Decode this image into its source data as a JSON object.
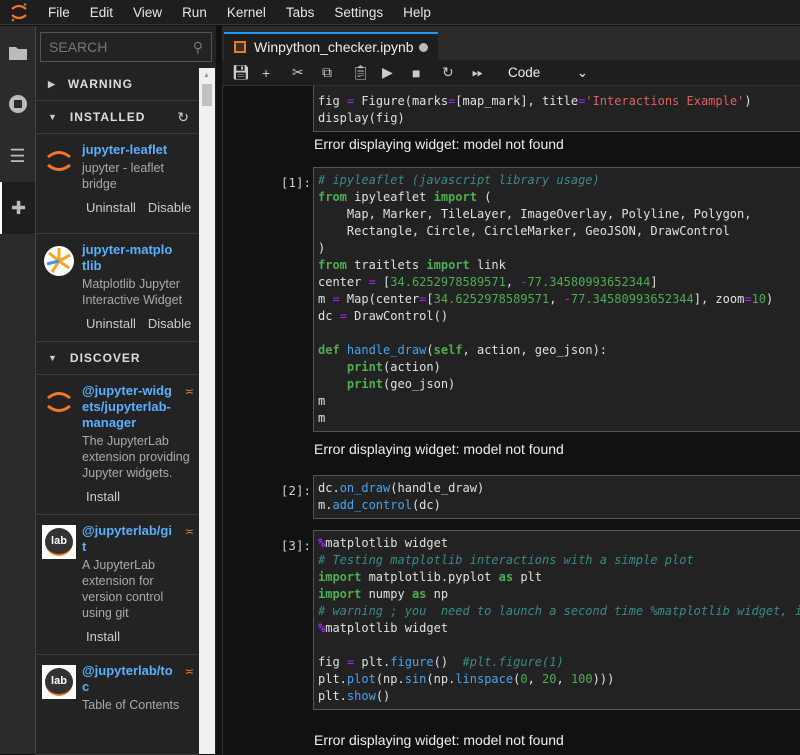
{
  "menubar": {
    "items": [
      "File",
      "Edit",
      "View",
      "Run",
      "Kernel",
      "Tabs",
      "Settings",
      "Help"
    ]
  },
  "sidebar": {
    "search_placeholder": "SEARCH",
    "sections": {
      "warning": "WARNING",
      "installed": "INSTALLED",
      "discover": "DISCOVER"
    },
    "installed": [
      {
        "name": "jupyter-leaflet",
        "desc": "jupyter - leaflet bridge",
        "buttons": [
          "Uninstall",
          "Disable"
        ]
      },
      {
        "name": "jupyter-matplotlib",
        "desc": "Matplotlib Jupyter Interactive Widget",
        "buttons": [
          "Uninstall",
          "Disable"
        ]
      }
    ],
    "discover": [
      {
        "name": "@jupyter-widgets/jupyterlab-manager",
        "desc": "The JupyterLab extension providing Jupyter widgets.",
        "button": "Install",
        "logo": "jupyter"
      },
      {
        "name": "@jupyterlab/git",
        "desc": "A JupyterLab extension for version control using git",
        "button": "Install",
        "logo": "lab"
      },
      {
        "name": "@jupyterlab/toc",
        "desc": "Table of Contents",
        "logo": "lab"
      }
    ]
  },
  "tab": {
    "title": "Winpython_checker.ipynb"
  },
  "toolbar": {
    "cell_type": "Code"
  },
  "cells": [
    {
      "prompt": "",
      "lines": [
        [
          [
            "p",
            "fig "
          ],
          [
            "o",
            "="
          ],
          [
            "p",
            " Figure(marks"
          ],
          [
            "o",
            "="
          ],
          [
            "p",
            "[map_mark], title"
          ],
          [
            "o",
            "="
          ],
          [
            "s",
            "'Interactions Example'"
          ],
          [
            "p",
            ")"
          ]
        ],
        [
          [
            "p",
            "display(fig)"
          ]
        ]
      ],
      "error": "Error displaying widget: model not found"
    },
    {
      "prompt": "[1]:",
      "lines": [
        [
          [
            "c",
            "# ipyleaflet (javascript library usage)"
          ]
        ],
        [
          [
            "k",
            "from"
          ],
          [
            "p",
            " ipyleaflet "
          ],
          [
            "k",
            "import"
          ],
          [
            "p",
            " ("
          ]
        ],
        [
          [
            "p",
            "    Map, Marker, TileLayer, ImageOverlay, Polyline, Polygon,"
          ]
        ],
        [
          [
            "p",
            "    Rectangle, Circle, CircleMarker, GeoJSON, DrawControl"
          ]
        ],
        [
          [
            "p",
            ")"
          ]
        ],
        [
          [
            "k",
            "from"
          ],
          [
            "p",
            " traitlets "
          ],
          [
            "k",
            "import"
          ],
          [
            "p",
            " link"
          ]
        ],
        [
          [
            "p",
            "center "
          ],
          [
            "o",
            "="
          ],
          [
            "p",
            " ["
          ],
          [
            "n",
            "34.6252978589571"
          ],
          [
            "p",
            ", "
          ],
          [
            "o",
            "-"
          ],
          [
            "n",
            "77.34580993652344"
          ],
          [
            "p",
            "]"
          ]
        ],
        [
          [
            "p",
            "m "
          ],
          [
            "o",
            "="
          ],
          [
            "p",
            " Map(center"
          ],
          [
            "o",
            "="
          ],
          [
            "p",
            "["
          ],
          [
            "n",
            "34.6252978589571"
          ],
          [
            "p",
            ", "
          ],
          [
            "o",
            "-"
          ],
          [
            "n",
            "77.34580993652344"
          ],
          [
            "p",
            "], zoom"
          ],
          [
            "o",
            "="
          ],
          [
            "n",
            "10"
          ],
          [
            "p",
            ")"
          ]
        ],
        [
          [
            "p",
            "dc "
          ],
          [
            "o",
            "="
          ],
          [
            "p",
            " DrawControl()"
          ]
        ],
        [
          [
            "p",
            ""
          ]
        ],
        [
          [
            "k",
            "def"
          ],
          [
            "f",
            " handle_draw"
          ],
          [
            "p",
            "("
          ],
          [
            "k",
            "self"
          ],
          [
            "p",
            ", action, geo_json):"
          ]
        ],
        [
          [
            "p",
            "    "
          ],
          [
            "k",
            "print"
          ],
          [
            "p",
            "(action)"
          ]
        ],
        [
          [
            "p",
            "    "
          ],
          [
            "k",
            "print"
          ],
          [
            "p",
            "(geo_json)"
          ]
        ],
        [
          [
            "p",
            "m"
          ]
        ],
        [
          [
            "p",
            "m"
          ]
        ]
      ],
      "error": "Error displaying widget: model not found"
    },
    {
      "prompt": "[2]:",
      "lines": [
        [
          [
            "p",
            "dc."
          ],
          [
            "f",
            "on_draw"
          ],
          [
            "p",
            "(handle_draw)"
          ]
        ],
        [
          [
            "p",
            "m."
          ],
          [
            "f",
            "add_control"
          ],
          [
            "p",
            "(dc)"
          ]
        ]
      ]
    },
    {
      "prompt": "[3]:",
      "lines": [
        [
          [
            "m",
            "%"
          ],
          [
            "p",
            "matplotlib widget"
          ]
        ],
        [
          [
            "c",
            "# Testing matplotlib interactions with a simple plot"
          ]
        ],
        [
          [
            "k",
            "import"
          ],
          [
            "p",
            " matplotlib.pyplot "
          ],
          [
            "k",
            "as"
          ],
          [
            "p",
            " plt"
          ]
        ],
        [
          [
            "k",
            "import"
          ],
          [
            "p",
            " numpy "
          ],
          [
            "k",
            "as"
          ],
          [
            "p",
            " np"
          ]
        ],
        [
          [
            "c",
            "# warning ; you  need to launch a second time %matplotlib widget, if"
          ]
        ],
        [
          [
            "m",
            "%"
          ],
          [
            "p",
            "matplotlib widget"
          ]
        ],
        [
          [
            "p",
            ""
          ]
        ],
        [
          [
            "p",
            "fig "
          ],
          [
            "o",
            "="
          ],
          [
            "p",
            " plt."
          ],
          [
            "f",
            "figure"
          ],
          [
            "p",
            "()  "
          ],
          [
            "c",
            "#plt.figure(1)"
          ]
        ],
        [
          [
            "p",
            "plt."
          ],
          [
            "f",
            "plot"
          ],
          [
            "p",
            "(np."
          ],
          [
            "f",
            "sin"
          ],
          [
            "p",
            "(np."
          ],
          [
            "f",
            "linspace"
          ],
          [
            "p",
            "("
          ],
          [
            "n",
            "0"
          ],
          [
            "p",
            ", "
          ],
          [
            "n",
            "20"
          ],
          [
            "p",
            ", "
          ],
          [
            "n",
            "100"
          ],
          [
            "p",
            ")))"
          ]
        ],
        [
          [
            "p",
            "plt."
          ],
          [
            "f",
            "show"
          ],
          [
            "p",
            "()"
          ]
        ]
      ],
      "error": "Error displaying widget: model not found"
    }
  ]
}
